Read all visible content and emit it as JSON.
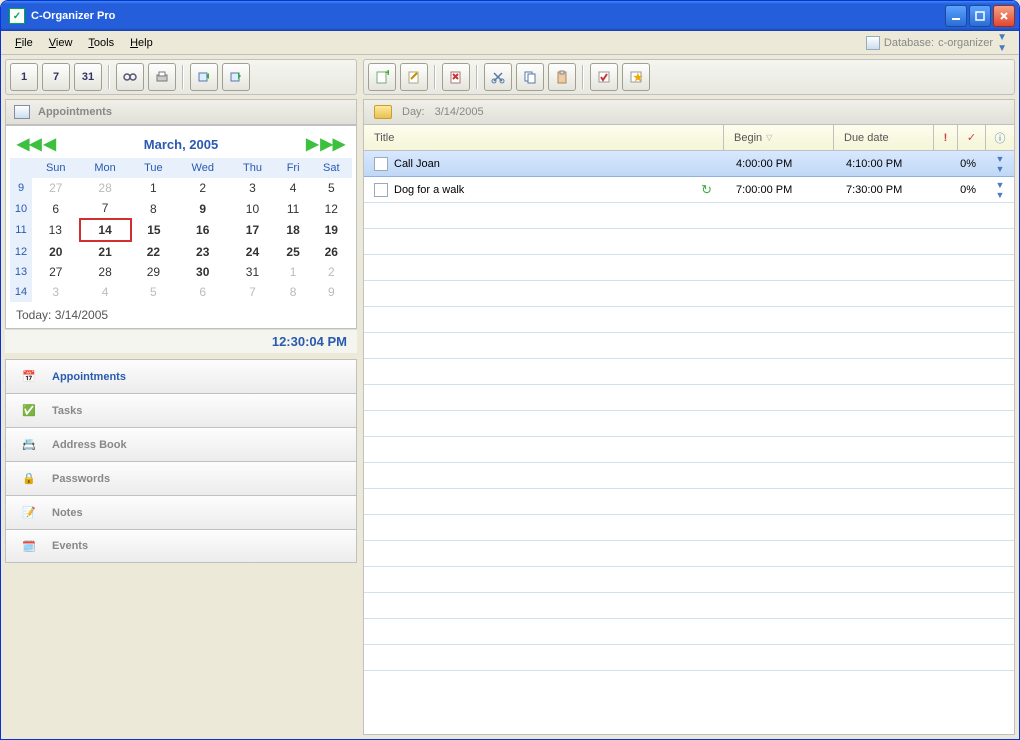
{
  "window": {
    "title": "C-Organizer Pro"
  },
  "menu": {
    "file": "File",
    "view": "View",
    "tools": "Tools",
    "help": "Help",
    "database_label": "Database:",
    "database_name": "c-organizer"
  },
  "left_toolbar": {
    "btn1": "1",
    "btn7": "7",
    "btn31": "31"
  },
  "section": {
    "appointments": "Appointments"
  },
  "calendar": {
    "month_title": "March, 2005",
    "days": [
      "Sun",
      "Mon",
      "Tue",
      "Wed",
      "Thu",
      "Fri",
      "Sat"
    ],
    "weeks": [
      {
        "wk": "9",
        "cells": [
          {
            "d": "27",
            "dim": true
          },
          {
            "d": "28",
            "dim": true
          },
          {
            "d": "1"
          },
          {
            "d": "2"
          },
          {
            "d": "3"
          },
          {
            "d": "4"
          },
          {
            "d": "5"
          }
        ]
      },
      {
        "wk": "10",
        "cells": [
          {
            "d": "6"
          },
          {
            "d": "7"
          },
          {
            "d": "8"
          },
          {
            "d": "9",
            "b": true
          },
          {
            "d": "10"
          },
          {
            "d": "11"
          },
          {
            "d": "12"
          }
        ]
      },
      {
        "wk": "11",
        "cells": [
          {
            "d": "13"
          },
          {
            "d": "14",
            "b": true,
            "sel": true
          },
          {
            "d": "15",
            "b": true
          },
          {
            "d": "16",
            "b": true
          },
          {
            "d": "17",
            "b": true
          },
          {
            "d": "18",
            "b": true
          },
          {
            "d": "19",
            "b": true
          }
        ]
      },
      {
        "wk": "12",
        "cells": [
          {
            "d": "20",
            "b": true
          },
          {
            "d": "21",
            "b": true
          },
          {
            "d": "22",
            "b": true
          },
          {
            "d": "23",
            "b": true
          },
          {
            "d": "24",
            "b": true
          },
          {
            "d": "25",
            "b": true
          },
          {
            "d": "26",
            "b": true
          }
        ]
      },
      {
        "wk": "13",
        "cells": [
          {
            "d": "27"
          },
          {
            "d": "28"
          },
          {
            "d": "29"
          },
          {
            "d": "30",
            "b": true
          },
          {
            "d": "31"
          },
          {
            "d": "1",
            "dim": true
          },
          {
            "d": "2",
            "dim": true
          }
        ]
      },
      {
        "wk": "14",
        "cells": [
          {
            "d": "3",
            "dim": true
          },
          {
            "d": "4",
            "dim": true
          },
          {
            "d": "5",
            "dim": true
          },
          {
            "d": "6",
            "dim": true
          },
          {
            "d": "7",
            "dim": true
          },
          {
            "d": "8",
            "dim": true
          },
          {
            "d": "9",
            "dim": true
          }
        ]
      }
    ],
    "today_label": "Today: 3/14/2005",
    "time": "12:30:04 PM"
  },
  "nav": {
    "items": [
      {
        "label": "Appointments",
        "active": true,
        "icon": "calendar"
      },
      {
        "label": "Tasks",
        "icon": "check"
      },
      {
        "label": "Address Book",
        "icon": "card"
      },
      {
        "label": "Passwords",
        "icon": "lock"
      },
      {
        "label": "Notes",
        "icon": "note"
      },
      {
        "label": "Events",
        "icon": "event"
      }
    ]
  },
  "day": {
    "label": "Day:",
    "date": "3/14/2005",
    "columns": {
      "title": "Title",
      "begin": "Begin",
      "due": "Due date"
    },
    "rows": [
      {
        "title": "Call Joan",
        "begin": "4:00:00 PM",
        "due": "4:10:00 PM",
        "pct": "0%",
        "selected": true,
        "recur": false
      },
      {
        "title": "Dog for a walk",
        "begin": "7:00:00 PM",
        "due": "7:30:00 PM",
        "pct": "0%",
        "recur": true
      }
    ]
  }
}
